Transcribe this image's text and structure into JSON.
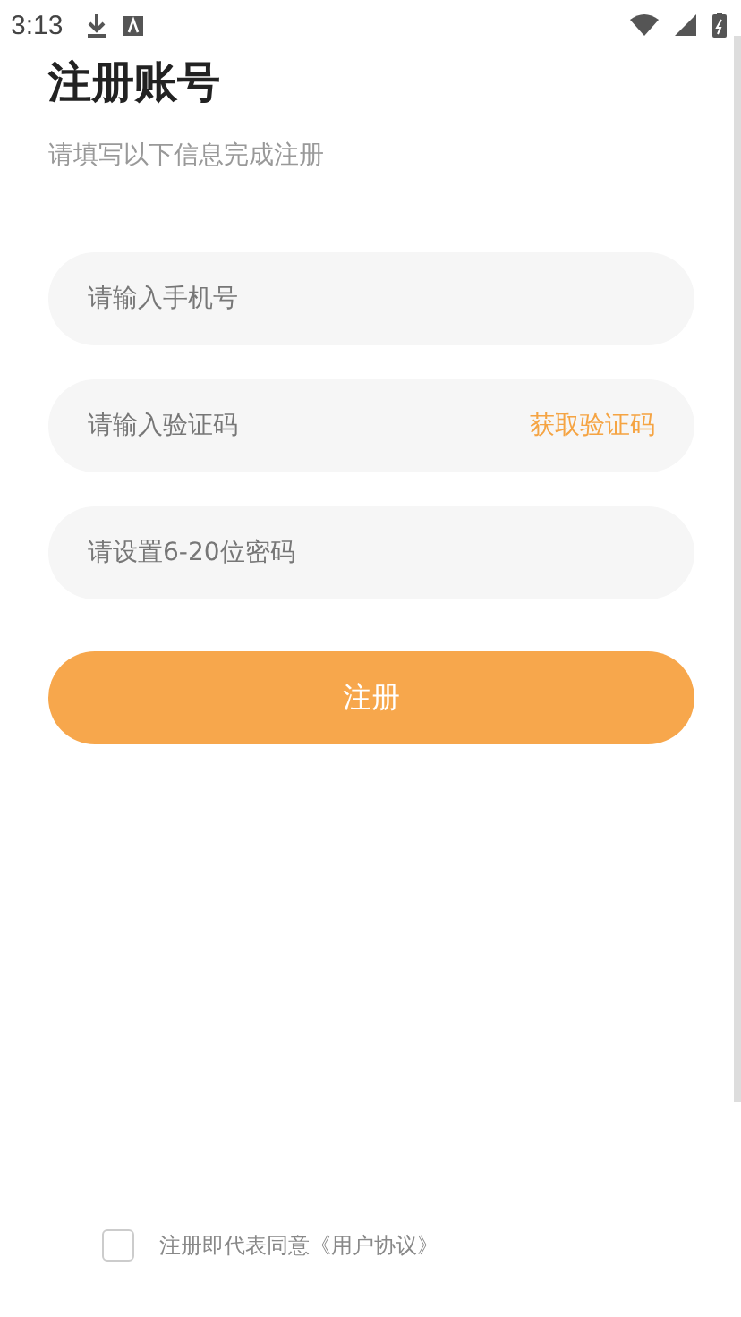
{
  "status_bar": {
    "time": "3:13"
  },
  "title": "注册账号",
  "subtitle": "请填写以下信息完成注册",
  "fields": [
    {
      "placeholder": "请输入手机号"
    },
    {
      "placeholder": "请输入验证码",
      "action": "获取验证码"
    },
    {
      "placeholder": "请设置6-20位密码"
    }
  ],
  "submit": "注册",
  "agreement": {
    "checked": false,
    "text": "注册即代表同意《用户协议》"
  }
}
